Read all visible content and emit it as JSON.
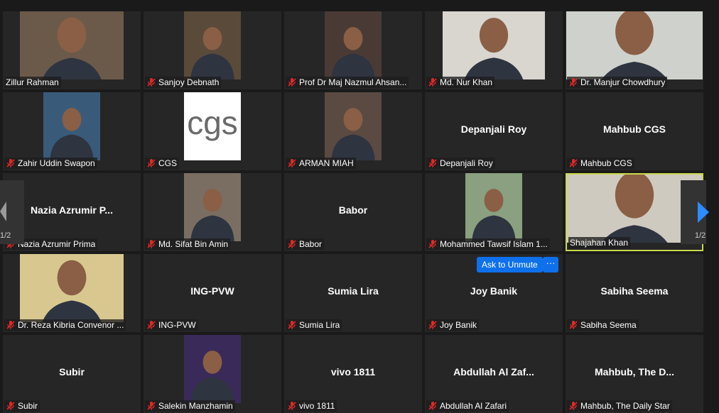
{
  "participants": [
    {
      "name": "Zillur Rahman",
      "muted": false,
      "video": true
    },
    {
      "name": "Sanjoy Debnath",
      "muted": true,
      "video": true
    },
    {
      "name": "Prof Dr Maj Nazmul Ahsan...",
      "muted": true,
      "video": true
    },
    {
      "name": "Md. Nur Khan",
      "muted": true,
      "video": true
    },
    {
      "name": "Dr. Manjur Chowdhury",
      "muted": true,
      "video": true
    },
    {
      "name": "Zahir Uddin Swapon",
      "muted": true,
      "video": true
    },
    {
      "name": "CGS",
      "muted": true,
      "video": true,
      "logo": "cgs"
    },
    {
      "name": "ARMAN MIAH",
      "muted": true,
      "video": true
    },
    {
      "name": "Depanjali Roy",
      "display": "Depanjali Roy",
      "muted": true,
      "video": false
    },
    {
      "name": "Mahbub CGS",
      "display": "Mahbub CGS",
      "muted": true,
      "video": false
    },
    {
      "name": "Nazia Azrumir Prima",
      "display": "Nazia Azrumir P...",
      "muted": true,
      "video": false
    },
    {
      "name": "Md. Sifat Bin Amin",
      "muted": true,
      "video": true
    },
    {
      "name": "Babor",
      "display": "Babor",
      "muted": true,
      "video": false
    },
    {
      "name": "Mohammed Tawsif Islam 1...",
      "muted": true,
      "video": true
    },
    {
      "name": "Shajahan Khan",
      "muted": false,
      "video": true,
      "active": true
    },
    {
      "name": "Dr. Reza Kibria Convenor ...",
      "muted": true,
      "video": true
    },
    {
      "name": "ING-PVW",
      "display": "ING-PVW",
      "muted": true,
      "video": false
    },
    {
      "name": "Sumia Lira",
      "display": "Sumia Lira",
      "muted": true,
      "video": false
    },
    {
      "name": "Joy Banik",
      "display": "Joy Banik",
      "muted": true,
      "video": false
    },
    {
      "name": "Sabiha Seema",
      "display": "Sabiha Seema",
      "muted": true,
      "video": false
    },
    {
      "name": "Subir",
      "display": "Subir",
      "muted": true,
      "video": false
    },
    {
      "name": "Salekin Manzhamin",
      "muted": true,
      "video": true
    },
    {
      "name": "vivo 1811",
      "display": "vivo 1811",
      "muted": true,
      "video": false
    },
    {
      "name": "Abdullah Al Zafari",
      "display": "Abdullah Al Zaf...",
      "muted": true,
      "video": false
    },
    {
      "name": "Mahbub, The Daily Star",
      "display": "Mahbub, The D...",
      "muted": true,
      "video": false
    }
  ],
  "logo_text": "cgs",
  "nav": {
    "left_page": "1/2",
    "right_page": "1/2"
  },
  "actions": {
    "ask_unmute": "Ask to Unmute",
    "more": "···"
  },
  "colors": {
    "active_border": "#c8d94a",
    "button": "#0e71eb",
    "muted_icon": "#e02828",
    "tile": "#262626"
  },
  "icons": {
    "muted": "mic-muted-icon",
    "prev": "chevron-left-icon",
    "next": "chevron-right-icon"
  }
}
